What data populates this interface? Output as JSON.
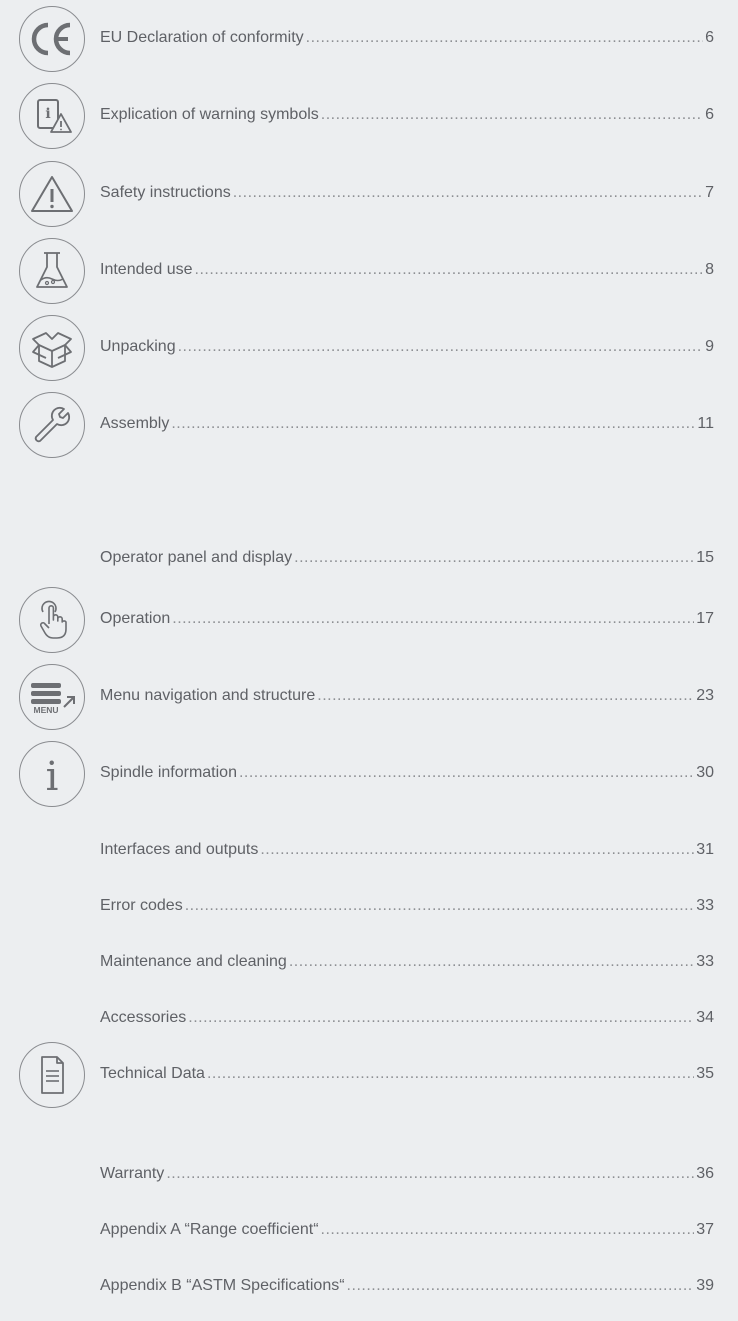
{
  "toc": {
    "entries": [
      {
        "title": "EU Declaration of conformity",
        "page": "6",
        "icon": "ce-mark-icon"
      },
      {
        "title": "Explication of warning symbols",
        "page": "6",
        "icon": "info-warning-icon"
      },
      {
        "title": "Safety instructions",
        "page": "7",
        "icon": "warning-triangle-icon"
      },
      {
        "title": "Intended use",
        "page": "8",
        "icon": "flask-icon"
      },
      {
        "title": "Unpacking",
        "page": "9",
        "icon": "open-box-icon"
      },
      {
        "title": "Assembly",
        "page": "11",
        "icon": "wrench-icon"
      },
      {
        "title": "Operator panel and display",
        "page": "15",
        "icon": ""
      },
      {
        "title": "Operation",
        "page": "17",
        "icon": "touch-hand-icon"
      },
      {
        "title": "Menu navigation and structure ",
        "page": "23",
        "icon": "menu-icon"
      },
      {
        "title": "Spindle information",
        "page": "30",
        "icon": "info-icon"
      },
      {
        "title": "Interfaces and outputs",
        "page": "31",
        "icon": ""
      },
      {
        "title": "Error codes",
        "page": "33",
        "icon": ""
      },
      {
        "title": "Maintenance and cleaning",
        "page": "33",
        "icon": ""
      },
      {
        "title": "Accessories",
        "page": "34",
        "icon": ""
      },
      {
        "title": "Technical Data",
        "page": "35",
        "icon": "document-icon"
      },
      {
        "title": "Warranty",
        "page": "36",
        "icon": ""
      },
      {
        "title": "Appendix A “Range coefficient“ ",
        "page": "37",
        "icon": ""
      },
      {
        "title": "Appendix B “ASTM Specifications“ ",
        "page": "39",
        "icon": ""
      }
    ],
    "menu_icon_label": "MENU"
  }
}
